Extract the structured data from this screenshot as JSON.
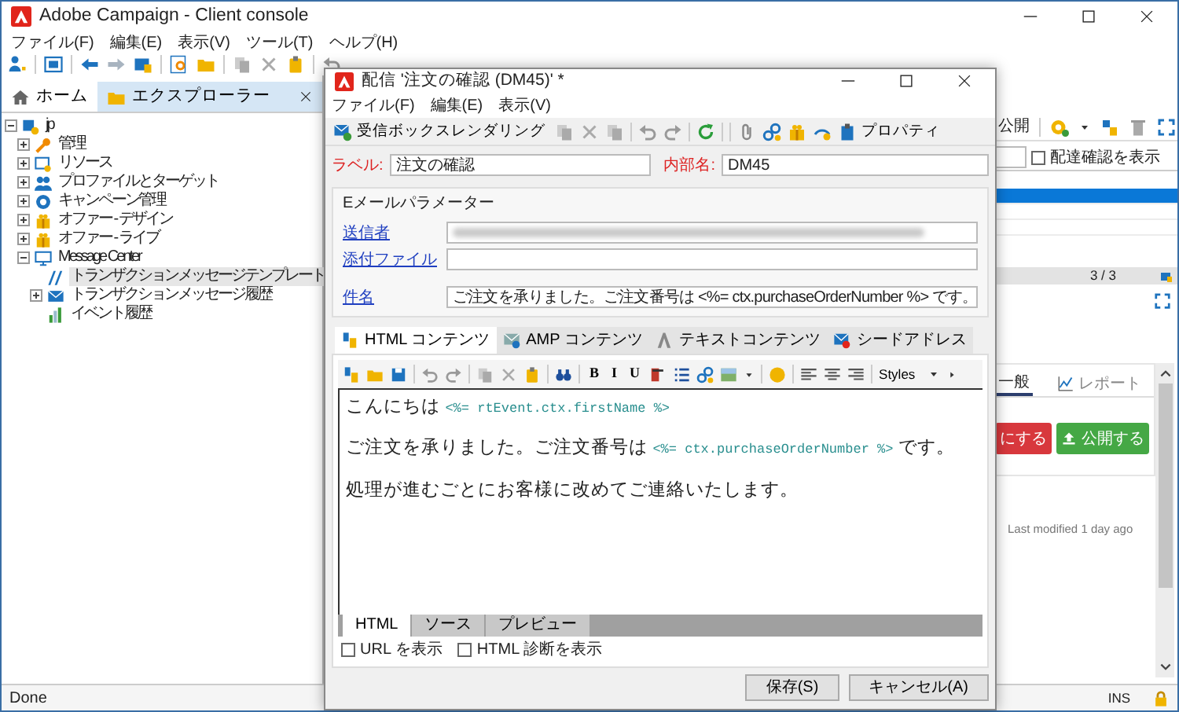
{
  "main_window": {
    "title": "Adobe Campaign - Client console",
    "menu": [
      "ファイル(F)",
      "編集(E)",
      "表示(V)",
      "ツール(T)",
      "ヘルプ(H)"
    ],
    "tabs": [
      {
        "label": "ホーム",
        "selected": false,
        "closable": false
      },
      {
        "label": "エクスプローラー",
        "selected": true,
        "closable": true
      }
    ],
    "tree": [
      {
        "label": "jp",
        "expanded": true,
        "selected": false,
        "children": [
          {
            "label": "管理",
            "expanded": false,
            "selected": false
          },
          {
            "label": "リソース",
            "expanded": false,
            "selected": false
          },
          {
            "label": "プロファイルとターゲット",
            "expanded": false,
            "selected": false
          },
          {
            "label": "キャンペーン管理",
            "expanded": false,
            "selected": false
          },
          {
            "label": "オファー - デザイン",
            "expanded": false,
            "selected": false
          },
          {
            "label": "オファー - ライブ",
            "expanded": false,
            "selected": false
          },
          {
            "label": "Message Center",
            "expanded": true,
            "selected": false,
            "children": [
              {
                "label": "トランザクションメッセージテンプレート",
                "selected": true
              },
              {
                "label": "トランザクションメッセージ履歴",
                "expanded": false,
                "selected": false
              },
              {
                "label": "イベント履歴",
                "selected": false
              }
            ]
          }
        ]
      }
    ],
    "right_panel": {
      "toolbar_label": "公開",
      "delivery_check": {
        "label": "配達確認を表示",
        "checked": false
      },
      "rows": [
        {
          "selected": true
        },
        {
          "selected": false
        },
        {
          "selected": false
        }
      ],
      "count": "3 / 3",
      "tabs": [
        {
          "label": "一般",
          "selected": true
        },
        {
          "label": "レポート",
          "selected": false
        }
      ],
      "buttons": [
        {
          "label": "にする",
          "kind": "danger"
        },
        {
          "label": "公開する",
          "kind": "success"
        }
      ],
      "last_modified": "Last modified 1 day ago"
    },
    "status_bar": {
      "text": "Done",
      "mode": "INS"
    }
  },
  "dialog": {
    "title": "配信 '注文の確認 (DM45)' *",
    "menu": [
      "ファイル(F)",
      "編集(E)",
      "表示(V)"
    ],
    "toolbar": {
      "rendering": "受信ボックスレンダリング",
      "properties": "プロパティ"
    },
    "label": {
      "caption": "ラベル:",
      "value": "注文の確認"
    },
    "internal_name": {
      "caption": "内部名:",
      "value": "DM45"
    },
    "email_params": {
      "legend": "Eメールパラメーター",
      "sender": {
        "caption": "送信者",
        "blurred": true
      },
      "attachment": {
        "caption": "添付ファイル"
      },
      "subject": {
        "caption": "件名",
        "value": "ご注文を承りました。ご注文番号は <%=  ctx.purchaseOrderNumber %> です。"
      }
    },
    "content_tabs": [
      {
        "label": "HTML コンテンツ",
        "selected": true
      },
      {
        "label": "AMP コンテンツ",
        "selected": false
      },
      {
        "label": "テキストコンテンツ",
        "selected": false
      },
      {
        "label": "シードアドレス",
        "selected": false
      }
    ],
    "editor": {
      "format_buttons": [
        "B",
        "I",
        "U"
      ],
      "styles": "Styles",
      "lines": [
        [
          {
            "kind": "text",
            "text": "こんにちは "
          },
          {
            "kind": "code",
            "text": "<%= rtEvent.ctx.firstName %>"
          }
        ],
        [
          {
            "kind": "text",
            "text": "ご注文を承りました。ご注文番号は "
          },
          {
            "kind": "code",
            "text": "<%= ctx.purchaseOrderNumber %>"
          },
          {
            "kind": "text",
            "text": " です。"
          }
        ],
        [
          {
            "kind": "text",
            "text": "処理が進むごとにお客様に改めてご連絡いたします。"
          }
        ]
      ],
      "view_tabs": [
        {
          "label": "HTML",
          "selected": true
        },
        {
          "label": "ソース",
          "selected": false
        },
        {
          "label": "プレビュー",
          "selected": false
        }
      ],
      "options": [
        {
          "label": "URL を表示",
          "checked": false
        },
        {
          "label": "HTML 診断を表示",
          "checked": false
        }
      ]
    },
    "buttons": [
      "保存(S)",
      "キャンセル(A)"
    ]
  }
}
